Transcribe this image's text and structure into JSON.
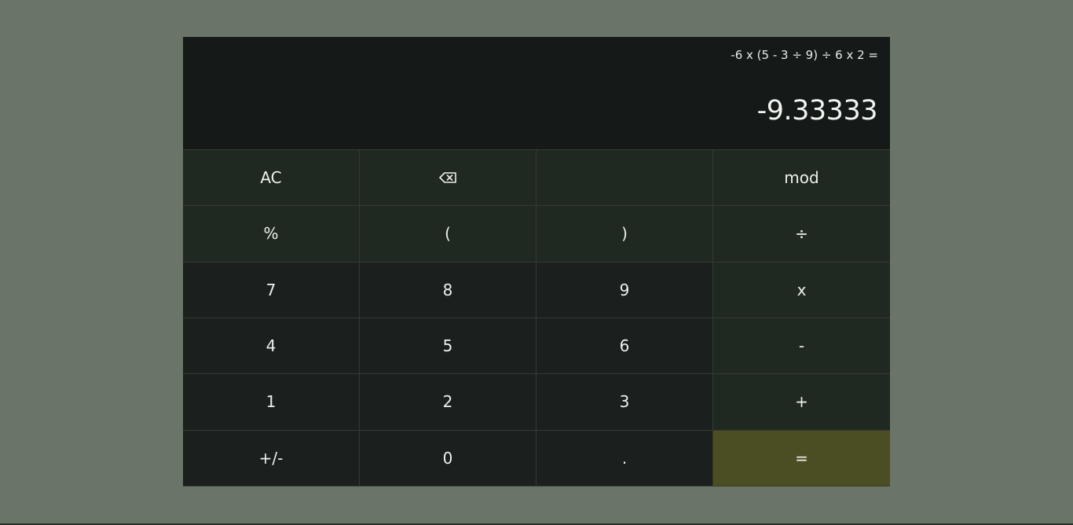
{
  "display": {
    "expression": "-6 x (5 - 3 ÷ 9) ÷ 6 x 2 =",
    "result": "-9.33333"
  },
  "keys": [
    {
      "label": "AC",
      "name": "clear-button",
      "kind": "fn"
    },
    {
      "label": "",
      "name": "backspace-button",
      "kind": "fn",
      "icon": "backspace-icon"
    },
    {
      "label": "",
      "name": "blank-button",
      "kind": "fn"
    },
    {
      "label": "mod",
      "name": "mod-button",
      "kind": "op"
    },
    {
      "label": "%",
      "name": "percent-button",
      "kind": "fn"
    },
    {
      "label": "(",
      "name": "open-paren-button",
      "kind": "fn"
    },
    {
      "label": ")",
      "name": "close-paren-button",
      "kind": "fn"
    },
    {
      "label": "÷",
      "name": "divide-button",
      "kind": "op"
    },
    {
      "label": "7",
      "name": "digit-7-button",
      "kind": "num"
    },
    {
      "label": "8",
      "name": "digit-8-button",
      "kind": "num"
    },
    {
      "label": "9",
      "name": "digit-9-button",
      "kind": "num"
    },
    {
      "label": "x",
      "name": "multiply-button",
      "kind": "op"
    },
    {
      "label": "4",
      "name": "digit-4-button",
      "kind": "num"
    },
    {
      "label": "5",
      "name": "digit-5-button",
      "kind": "num"
    },
    {
      "label": "6",
      "name": "digit-6-button",
      "kind": "num"
    },
    {
      "label": "-",
      "name": "subtract-button",
      "kind": "op"
    },
    {
      "label": "1",
      "name": "digit-1-button",
      "kind": "num"
    },
    {
      "label": "2",
      "name": "digit-2-button",
      "kind": "num"
    },
    {
      "label": "3",
      "name": "digit-3-button",
      "kind": "num"
    },
    {
      "label": "+",
      "name": "add-button",
      "kind": "op"
    },
    {
      "label": "+/-",
      "name": "negate-button",
      "kind": "num"
    },
    {
      "label": "0",
      "name": "digit-0-button",
      "kind": "num"
    },
    {
      "label": ".",
      "name": "decimal-button",
      "kind": "num"
    },
    {
      "label": "=",
      "name": "equals-button",
      "kind": "eq"
    }
  ],
  "colors": {
    "page_background": "#6a7468",
    "display_background": "#151a18",
    "function_key": "#202822",
    "number_key": "#1b201e",
    "equals_key": "#4b4d22",
    "text": "#eef1ec"
  }
}
